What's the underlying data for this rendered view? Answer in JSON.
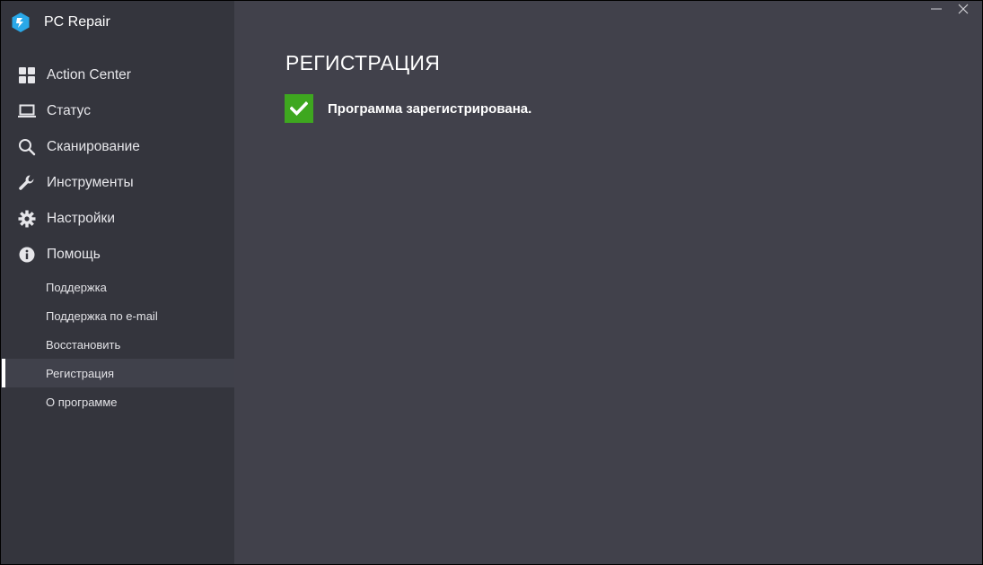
{
  "app": {
    "title": "PC Repair"
  },
  "nav": [
    {
      "label": "Action Center",
      "icon": "grid-icon"
    },
    {
      "label": "Статус",
      "icon": "laptop-icon"
    },
    {
      "label": "Сканирование",
      "icon": "search-icon"
    },
    {
      "label": "Инструменты",
      "icon": "wrench-icon"
    },
    {
      "label": "Настройки",
      "icon": "gear-icon"
    },
    {
      "label": "Помощь",
      "icon": "info-icon"
    }
  ],
  "help_sub": [
    {
      "label": "Поддержка"
    },
    {
      "label": "Поддержка по e-mail"
    },
    {
      "label": "Восстановить"
    },
    {
      "label": "Регистрация",
      "active": true
    },
    {
      "label": "О программе"
    }
  ],
  "main": {
    "title": "РЕГИСТРАЦИЯ",
    "status_text": "Программа зарегистрирована."
  },
  "colors": {
    "sidebar_bg": "#34353d",
    "main_bg": "#41414b",
    "success_green": "#3ea71f",
    "logo_blue": "#2aa8e8"
  }
}
